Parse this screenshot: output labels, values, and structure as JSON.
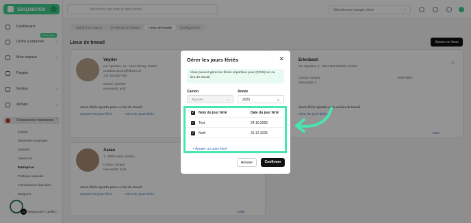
{
  "app": {
    "name": "sequence"
  },
  "sidebar": {
    "items": [
      {
        "label": "Dashboard"
      },
      {
        "label": "Ordre à importer"
      },
      {
        "label": "Mon espace"
      },
      {
        "label": "Projets"
      },
      {
        "label": "Gestes"
      },
      {
        "label": "Achats"
      },
      {
        "label": "Ressources humaines"
      }
    ],
    "new_badge": "Nouveau",
    "subitems": [
      "Equipe",
      "Dépenses employés",
      "Salaires",
      "Absences",
      "Entreprise",
      "Politique salariale",
      "Transmission fiduciaire",
      "Rapports"
    ],
    "active_subitem": "Entreprise",
    "user": "SequenceFi Lauffer..."
  },
  "topbar": {
    "search_placeholder": "Recherche par nom et date clients",
    "client_select": "Sélectionner compte client"
  },
  "main": {
    "tabs": [
      "Impôt à la source",
      "Certificat de Salaire",
      "Lieux de travail",
      "Configuration"
    ],
    "active_tab": "Lieux de travail",
    "section_title": "Lieux de travail",
    "add_button": "Ajouter un lieux",
    "cards": [
      {
        "name": "Veyrier",
        "lines": [
          "rue Kgsuisse, 14 - 1234 Weerg, Suisse",
          "jonathan.spoon@hiforeo.ch",
          "+41 0221557700",
          "Canton: Genève",
          "InHouseID: ecdf"
        ],
        "holidays_title": "Jours fériés ajoutés pour ce lieu de travail",
        "link_import": "Importer les jours fériés",
        "link_manage": "Gérer les jours fériés"
      },
      {
        "name": "Erlenbach",
        "lines": [
          "rue Kgsuisse, 1 - 5017 Barmelweid, Suisse",
          "Canton: Aargau",
          "InHouseID: d"
        ],
        "extra": "BUR-WEG",
        "holidays_title": "Jours fériés ajoutés pour ce lieu de travail",
        "link_import": "Importer les jours fériés",
        "link_manage": "Gérer les jours fériés"
      },
      {
        "name": "Aarau",
        "lines": [
          "1 - 5000 Aarau, Suisse",
          "Canton: Aargau",
          "InHouseID: bcds"
        ],
        "holidays_title": "Jours fériés ajoutés pour ce lieu de travail",
        "link_import": "Importer les jours fériés",
        "link_manage": "Gérer les jours fériés"
      }
    ],
    "edit_label": "Edite"
  },
  "modal": {
    "title": "Gérer les jours fériés",
    "info": "Vous pouvez gérer les fériés importées pour (2025) sur ce lieu de travail.",
    "canton_label": "Canton",
    "canton_value": "Argovie",
    "year_label": "Année",
    "year_value": "2025",
    "col_name": "Nom du jour férié",
    "col_date": "Date du jour férié",
    "rows": [
      {
        "name": "Test",
        "date": "24.10.2025",
        "checked": true
      },
      {
        "name": "Noël",
        "date": "25.12.2025",
        "checked": true
      }
    ],
    "add_link": "+ Ajouter un autre férié",
    "cancel": "Annuler",
    "confirm": "Confirmer"
  },
  "colors": {
    "accent": "#3ecf8e",
    "highlight": "#47e6b1",
    "dark": "#111111"
  },
  "help_count": "26"
}
